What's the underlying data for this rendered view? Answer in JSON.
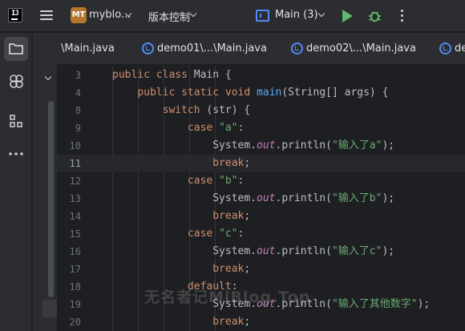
{
  "titlebar": {
    "project_badge": "MT",
    "project_name": "myblo...",
    "vcs_label": "版本控制",
    "run_config": "Main (3)"
  },
  "tabs": [
    {
      "label": "\\Main.java"
    },
    {
      "label": "demo01\\...\\Main.java"
    },
    {
      "label": "demo02\\...\\Main.java"
    },
    {
      "label": "de"
    }
  ],
  "editor": {
    "current_line": "11",
    "lines": [
      {
        "n": "3",
        "code": "public class Main {"
      },
      {
        "n": "4",
        "code": "    public static void main(String[] args) {"
      },
      {
        "n": "8",
        "code": "        switch (str) {"
      },
      {
        "n": "9",
        "code": "            case \"a\":"
      },
      {
        "n": "10",
        "code": "                System.out.println(\"输入了a\");"
      },
      {
        "n": "11",
        "code": "                break;"
      },
      {
        "n": "12",
        "code": "            case \"b\":"
      },
      {
        "n": "13",
        "code": "                System.out.println(\"输入了b\");"
      },
      {
        "n": "14",
        "code": "                break;"
      },
      {
        "n": "15",
        "code": "            case \"c\":"
      },
      {
        "n": "16",
        "code": "                System.out.println(\"输入了c\");"
      },
      {
        "n": "17",
        "code": "                break;"
      },
      {
        "n": "18",
        "code": "            default:"
      },
      {
        "n": "19",
        "code": "                System.out.println(\"输入了其他数字\");"
      },
      {
        "n": "20",
        "code": "                break;"
      }
    ]
  },
  "watermark": "无名者记MiBlog.Top",
  "icons": {
    "app_logo": "intellij-icon",
    "menu": "hamburger-icon",
    "run_config": "run-config-icon",
    "run": "play-icon",
    "debug": "bug-icon",
    "more": "more-vertical-icon",
    "project": "folder-icon",
    "services": "services-icon",
    "structure": "structure-icon",
    "more_tools": "more-horizontal-icon",
    "java_class": "java-class-icon"
  },
  "colors": {
    "background": "#1e1f22",
    "panel": "#2b2d30",
    "keyword": "#cf8e6d",
    "function": "#56a8f5",
    "string": "#6aab73",
    "field": "#c77dbb",
    "plain": "#bcbec4",
    "accent": "#548af7",
    "run": "#5fb865"
  }
}
